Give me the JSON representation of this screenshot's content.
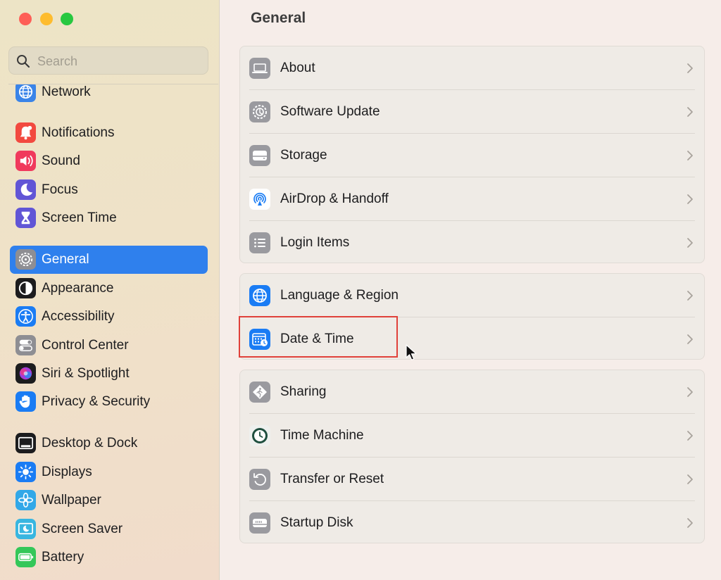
{
  "window": {
    "traffic_lights": [
      {
        "name": "close",
        "color": "#fe5f57"
      },
      {
        "name": "minimize",
        "color": "#febc2e"
      },
      {
        "name": "zoom",
        "color": "#28c840"
      }
    ]
  },
  "search": {
    "placeholder": "Search",
    "value": ""
  },
  "sidebar": {
    "selected": "General",
    "selected_color": "#2f80ed",
    "items": [
      {
        "label": "Network",
        "icon": "globe-icon",
        "color": "#3a84e8"
      },
      {
        "label": "Notifications",
        "icon": "bell-icon",
        "color": "#f2493f"
      },
      {
        "label": "Sound",
        "icon": "speaker-icon",
        "color": "#f0395c"
      },
      {
        "label": "Focus",
        "icon": "moon-icon",
        "color": "#6155d6"
      },
      {
        "label": "Screen Time",
        "icon": "hourglass-icon",
        "color": "#6155d6"
      },
      {
        "label": "General",
        "icon": "gear-icon",
        "color": "#8e8e93"
      },
      {
        "label": "Appearance",
        "icon": "appearance-icon",
        "color": "#1c1c1e"
      },
      {
        "label": "Accessibility",
        "icon": "accessibility-icon",
        "color": "#1a7cf4"
      },
      {
        "label": "Control Center",
        "icon": "toggles-icon",
        "color": "#8e8e93"
      },
      {
        "label": "Siri & Spotlight",
        "icon": "siri-icon",
        "color": "#1c1c1e"
      },
      {
        "label": "Privacy & Security",
        "icon": "hand-icon",
        "color": "#1a7cf4"
      },
      {
        "label": "Desktop & Dock",
        "icon": "dock-icon",
        "color": "#1c1c1e"
      },
      {
        "label": "Displays",
        "icon": "sun-icon",
        "color": "#1a7cf4"
      },
      {
        "label": "Wallpaper",
        "icon": "flower-icon",
        "color": "#32a8e8"
      },
      {
        "label": "Screen Saver",
        "icon": "screensaver-icon",
        "color": "#38b6e0"
      },
      {
        "label": "Battery",
        "icon": "battery-icon",
        "color": "#34c759"
      }
    ]
  },
  "main": {
    "title": "General",
    "groups": [
      {
        "rows": [
          {
            "label": "About",
            "icon": "laptop-icon"
          },
          {
            "label": "Software Update",
            "icon": "software-update-icon"
          },
          {
            "label": "Storage",
            "icon": "storage-icon"
          },
          {
            "label": "AirDrop & Handoff",
            "icon": "airdrop-icon"
          },
          {
            "label": "Login Items",
            "icon": "list-icon"
          }
        ]
      },
      {
        "rows": [
          {
            "label": "Language & Region",
            "icon": "globe-icon"
          },
          {
            "label": "Date & Time",
            "icon": "calendar-clock-icon"
          }
        ]
      },
      {
        "rows": [
          {
            "label": "Sharing",
            "icon": "sharing-icon"
          },
          {
            "label": "Time Machine",
            "icon": "time-machine-icon"
          },
          {
            "label": "Transfer or Reset",
            "icon": "reset-icon"
          },
          {
            "label": "Startup Disk",
            "icon": "disk-icon"
          }
        ]
      }
    ],
    "highlighted_row": "Date & Time",
    "highlight_color": "#e0413a"
  }
}
